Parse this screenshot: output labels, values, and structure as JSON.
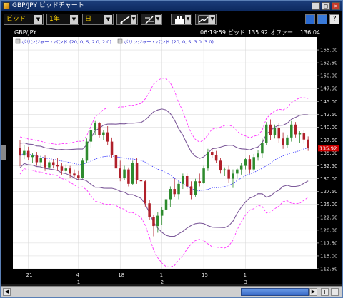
{
  "window": {
    "title": "GBP/JPY ビッドチャート",
    "minimize_icon": "minimize-icon",
    "maximize_icon": "maximize-icon",
    "close_icon": "close-icon"
  },
  "toolbar": {
    "price_type": "ビッド",
    "range": "1年",
    "interval": "日",
    "tools": [
      "line-draw-icon",
      "fibonacci-icon",
      "indicator-icon",
      "chart-type-icon"
    ],
    "right_icons": [
      "window-tile-icon",
      "layout-icon",
      "help-icon"
    ]
  },
  "chart_header": {
    "symbol": "GBP/JPY",
    "time": "06:19:59",
    "bid_label": "ビッド",
    "bid": "135.92",
    "offer_label": "オファー",
    "offer": "136.04"
  },
  "legend": [
    {
      "label": "ボリンジャー・バンド (20, 0, S, 2.0, 2.0)"
    },
    {
      "label": "ボリンジャー・バンド (20, 0, S, 3.0, 3.0)"
    }
  ],
  "current_price_tag": "135.92",
  "colors": {
    "up": "#2e8b2e",
    "down": "#b0202a",
    "band2": "#7d5a9a",
    "band3": "#ff33ff",
    "ma": "#3333ff",
    "price_tag": "#cc0000"
  },
  "chart_data": {
    "type": "candlestick",
    "ylim": [
      112.5,
      157.5
    ],
    "y_ticks": [
      "155.00",
      "152.50",
      "150.00",
      "147.50",
      "145.00",
      "142.50",
      "140.00",
      "137.50",
      "135.00",
      "132.50",
      "130.00",
      "127.50",
      "125.00",
      "122.50",
      "120.00",
      "117.50",
      "115.00",
      "112.50"
    ],
    "x_ticks": [
      "21",
      "4",
      "18",
      "1",
      "15",
      "1"
    ],
    "x_subticks": [
      "1",
      "2",
      "3"
    ],
    "candles": [
      {
        "o": 136.0,
        "h": 137.5,
        "l": 132.4,
        "c": 134.5
      },
      {
        "o": 134.5,
        "h": 136.5,
        "l": 133.8,
        "c": 135.4
      },
      {
        "o": 135.4,
        "h": 136.2,
        "l": 133.6,
        "c": 134.2
      },
      {
        "o": 134.2,
        "h": 135.0,
        "l": 133.0,
        "c": 134.5
      },
      {
        "o": 134.5,
        "h": 135.2,
        "l": 132.5,
        "c": 133.2
      },
      {
        "o": 133.2,
        "h": 134.6,
        "l": 132.0,
        "c": 134.0
      },
      {
        "o": 134.0,
        "h": 134.5,
        "l": 131.5,
        "c": 132.2
      },
      {
        "o": 132.2,
        "h": 133.5,
        "l": 131.8,
        "c": 133.2
      },
      {
        "o": 133.2,
        "h": 133.8,
        "l": 132.0,
        "c": 132.6
      },
      {
        "o": 132.6,
        "h": 134.0,
        "l": 131.5,
        "c": 132.4
      },
      {
        "o": 132.4,
        "h": 133.0,
        "l": 130.8,
        "c": 131.5
      },
      {
        "o": 131.5,
        "h": 132.8,
        "l": 131.0,
        "c": 132.0
      },
      {
        "o": 132.0,
        "h": 132.5,
        "l": 130.2,
        "c": 131.0
      },
      {
        "o": 131.0,
        "h": 131.8,
        "l": 130.0,
        "c": 130.6
      },
      {
        "o": 130.6,
        "h": 131.5,
        "l": 129.8,
        "c": 130.2
      },
      {
        "o": 130.2,
        "h": 134.0,
        "l": 130.0,
        "c": 133.5
      },
      {
        "o": 133.5,
        "h": 137.8,
        "l": 133.0,
        "c": 137.2
      },
      {
        "o": 137.2,
        "h": 140.5,
        "l": 136.0,
        "c": 139.5
      },
      {
        "o": 139.5,
        "h": 141.2,
        "l": 138.5,
        "c": 140.8
      },
      {
        "o": 140.8,
        "h": 141.0,
        "l": 138.0,
        "c": 138.5
      },
      {
        "o": 138.5,
        "h": 139.5,
        "l": 137.5,
        "c": 139.0
      },
      {
        "o": 139.0,
        "h": 140.2,
        "l": 136.5,
        "c": 137.2
      },
      {
        "o": 137.2,
        "h": 138.0,
        "l": 134.0,
        "c": 134.6
      },
      {
        "o": 134.6,
        "h": 135.0,
        "l": 131.5,
        "c": 132.0
      },
      {
        "o": 132.0,
        "h": 133.5,
        "l": 129.5,
        "c": 130.2
      },
      {
        "o": 130.2,
        "h": 132.5,
        "l": 129.8,
        "c": 131.8
      },
      {
        "o": 131.8,
        "h": 132.2,
        "l": 128.5,
        "c": 129.0
      },
      {
        "o": 129.0,
        "h": 133.5,
        "l": 128.8,
        "c": 133.0
      },
      {
        "o": 133.0,
        "h": 134.0,
        "l": 129.0,
        "c": 129.8
      },
      {
        "o": 129.8,
        "h": 131.5,
        "l": 128.0,
        "c": 129.5
      },
      {
        "o": 129.5,
        "h": 129.8,
        "l": 124.5,
        "c": 125.2
      },
      {
        "o": 125.2,
        "h": 125.8,
        "l": 122.0,
        "c": 122.6
      },
      {
        "o": 122.6,
        "h": 123.0,
        "l": 118.8,
        "c": 120.8
      },
      {
        "o": 120.8,
        "h": 123.5,
        "l": 119.5,
        "c": 122.8
      },
      {
        "o": 122.8,
        "h": 124.5,
        "l": 121.0,
        "c": 124.0
      },
      {
        "o": 124.0,
        "h": 126.5,
        "l": 123.0,
        "c": 126.0
      },
      {
        "o": 126.0,
        "h": 128.5,
        "l": 124.5,
        "c": 128.0
      },
      {
        "o": 128.0,
        "h": 130.0,
        "l": 126.5,
        "c": 127.0
      },
      {
        "o": 127.0,
        "h": 129.5,
        "l": 126.0,
        "c": 129.0
      },
      {
        "o": 129.0,
        "h": 131.0,
        "l": 128.0,
        "c": 130.5
      },
      {
        "o": 130.5,
        "h": 131.0,
        "l": 128.0,
        "c": 128.5
      },
      {
        "o": 128.5,
        "h": 129.5,
        "l": 126.0,
        "c": 126.8
      },
      {
        "o": 126.8,
        "h": 130.0,
        "l": 126.5,
        "c": 129.5
      },
      {
        "o": 129.5,
        "h": 131.0,
        "l": 128.5,
        "c": 129.2
      },
      {
        "o": 129.2,
        "h": 132.5,
        "l": 129.0,
        "c": 132.0
      },
      {
        "o": 132.0,
        "h": 135.8,
        "l": 131.5,
        "c": 135.2
      },
      {
        "o": 135.2,
        "h": 136.0,
        "l": 134.0,
        "c": 134.6
      },
      {
        "o": 134.6,
        "h": 135.4,
        "l": 133.0,
        "c": 133.5
      },
      {
        "o": 133.5,
        "h": 134.0,
        "l": 131.0,
        "c": 131.6
      },
      {
        "o": 131.6,
        "h": 132.2,
        "l": 130.5,
        "c": 131.8
      },
      {
        "o": 131.8,
        "h": 132.5,
        "l": 129.2,
        "c": 130.0
      },
      {
        "o": 130.0,
        "h": 131.8,
        "l": 128.2,
        "c": 131.0
      },
      {
        "o": 131.0,
        "h": 132.0,
        "l": 130.0,
        "c": 131.8
      },
      {
        "o": 131.8,
        "h": 133.0,
        "l": 130.8,
        "c": 132.5
      },
      {
        "o": 132.5,
        "h": 134.0,
        "l": 131.8,
        "c": 133.8
      },
      {
        "o": 133.8,
        "h": 134.5,
        "l": 131.0,
        "c": 131.8
      },
      {
        "o": 131.8,
        "h": 134.8,
        "l": 131.5,
        "c": 134.2
      },
      {
        "o": 134.2,
        "h": 135.6,
        "l": 133.5,
        "c": 134.9
      },
      {
        "o": 134.9,
        "h": 137.8,
        "l": 134.0,
        "c": 137.0
      },
      {
        "o": 137.0,
        "h": 141.0,
        "l": 136.5,
        "c": 140.5
      },
      {
        "o": 140.5,
        "h": 141.5,
        "l": 137.5,
        "c": 138.5
      },
      {
        "o": 138.5,
        "h": 140.5,
        "l": 137.8,
        "c": 139.8
      },
      {
        "o": 139.8,
        "h": 140.8,
        "l": 137.0,
        "c": 137.8
      },
      {
        "o": 137.8,
        "h": 139.0,
        "l": 135.8,
        "c": 136.5
      },
      {
        "o": 136.5,
        "h": 138.5,
        "l": 136.0,
        "c": 138.0
      },
      {
        "o": 138.0,
        "h": 141.2,
        "l": 137.2,
        "c": 140.5
      },
      {
        "o": 140.5,
        "h": 141.0,
        "l": 138.0,
        "c": 138.6
      },
      {
        "o": 138.6,
        "h": 139.2,
        "l": 137.0,
        "c": 138.8
      },
      {
        "o": 138.8,
        "h": 139.5,
        "l": 136.8,
        "c": 137.6
      },
      {
        "o": 137.6,
        "h": 138.2,
        "l": 135.4,
        "c": 135.92
      }
    ]
  }
}
